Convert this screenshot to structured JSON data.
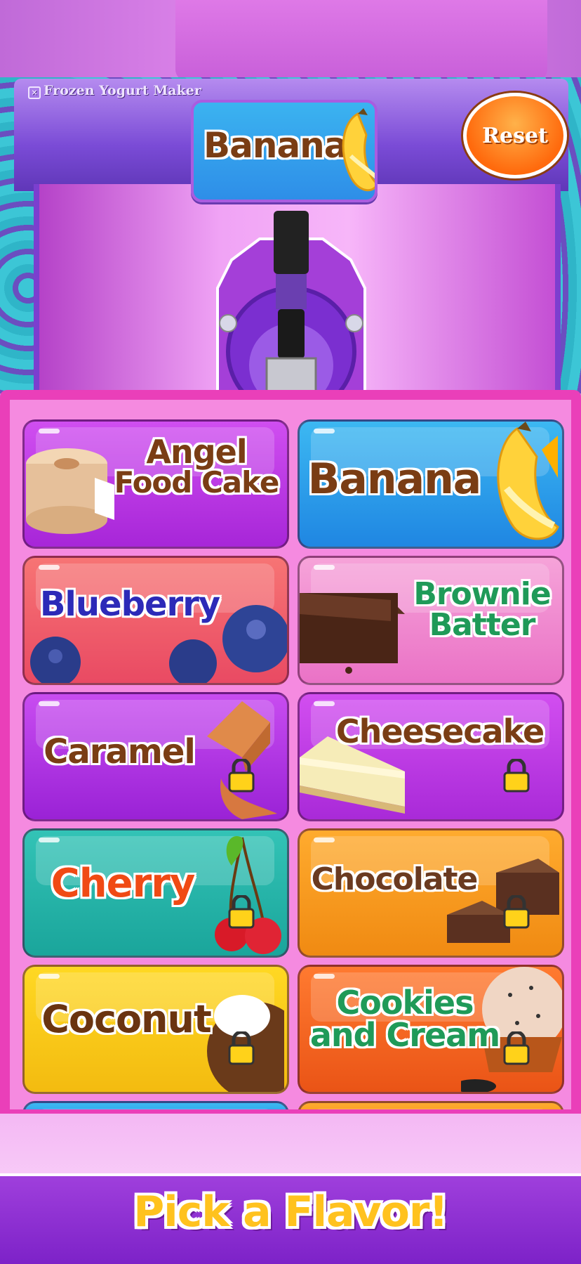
{
  "app": {
    "title": "Frozen Yogurt Maker",
    "reset_label": "Reset",
    "current_flavor": "Banana",
    "footer_prompt": "Pick a Flavor!"
  },
  "flavors": [
    {
      "name": "Angel Food Cake",
      "line1": "Angel",
      "line2": "Food Cake",
      "locked": false,
      "icon": "angel-food-cake-icon"
    },
    {
      "name": "Banana",
      "line1": "Banana",
      "line2": "",
      "locked": false,
      "icon": "banana-icon"
    },
    {
      "name": "Blueberry",
      "line1": "Blueberry",
      "line2": "",
      "locked": false,
      "icon": "blueberry-icon"
    },
    {
      "name": "Brownie Batter",
      "line1": "Brownie",
      "line2": "Batter",
      "locked": false,
      "icon": "brownie-icon"
    },
    {
      "name": "Caramel",
      "line1": "Caramel",
      "line2": "",
      "locked": true,
      "icon": "caramel-icon"
    },
    {
      "name": "Cheesecake",
      "line1": "Cheesecake",
      "line2": "",
      "locked": true,
      "icon": "cheesecake-icon"
    },
    {
      "name": "Cherry",
      "line1": "Cherry",
      "line2": "",
      "locked": true,
      "icon": "cherry-icon"
    },
    {
      "name": "Chocolate",
      "line1": "Chocolate",
      "line2": "",
      "locked": true,
      "icon": "chocolate-icon"
    },
    {
      "name": "Coconut",
      "line1": "Coconut",
      "line2": "",
      "locked": true,
      "icon": "coconut-icon"
    },
    {
      "name": "Cookies and Cream",
      "line1": "Cookies",
      "line2": "and Cream",
      "locked": true,
      "icon": "cookies-cream-icon"
    }
  ],
  "colors": {
    "panel_border": "#ea3fb9",
    "panel_fill": "#f58ae0",
    "footer_bar": "#8a2ed0",
    "footer_text": "#ffc21e",
    "reset_button": "#ff6a0d"
  }
}
